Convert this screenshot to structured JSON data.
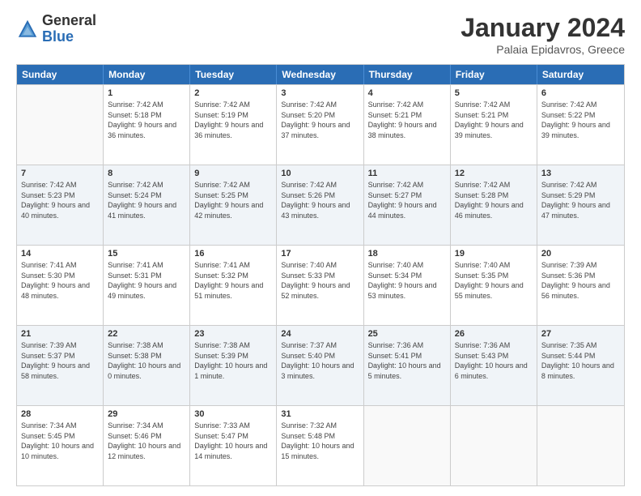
{
  "logo": {
    "general": "General",
    "blue": "Blue"
  },
  "title": {
    "month": "January 2024",
    "location": "Palaia Epidavros, Greece"
  },
  "calendar": {
    "days": [
      "Sunday",
      "Monday",
      "Tuesday",
      "Wednesday",
      "Thursday",
      "Friday",
      "Saturday"
    ],
    "rows": [
      [
        {
          "day": "",
          "sunrise": "",
          "sunset": "",
          "daylight": "",
          "empty": true
        },
        {
          "day": "1",
          "sunrise": "Sunrise: 7:42 AM",
          "sunset": "Sunset: 5:18 PM",
          "daylight": "Daylight: 9 hours and 36 minutes."
        },
        {
          "day": "2",
          "sunrise": "Sunrise: 7:42 AM",
          "sunset": "Sunset: 5:19 PM",
          "daylight": "Daylight: 9 hours and 36 minutes."
        },
        {
          "day": "3",
          "sunrise": "Sunrise: 7:42 AM",
          "sunset": "Sunset: 5:20 PM",
          "daylight": "Daylight: 9 hours and 37 minutes."
        },
        {
          "day": "4",
          "sunrise": "Sunrise: 7:42 AM",
          "sunset": "Sunset: 5:21 PM",
          "daylight": "Daylight: 9 hours and 38 minutes."
        },
        {
          "day": "5",
          "sunrise": "Sunrise: 7:42 AM",
          "sunset": "Sunset: 5:21 PM",
          "daylight": "Daylight: 9 hours and 39 minutes."
        },
        {
          "day": "6",
          "sunrise": "Sunrise: 7:42 AM",
          "sunset": "Sunset: 5:22 PM",
          "daylight": "Daylight: 9 hours and 39 minutes."
        }
      ],
      [
        {
          "day": "7",
          "sunrise": "Sunrise: 7:42 AM",
          "sunset": "Sunset: 5:23 PM",
          "daylight": "Daylight: 9 hours and 40 minutes."
        },
        {
          "day": "8",
          "sunrise": "Sunrise: 7:42 AM",
          "sunset": "Sunset: 5:24 PM",
          "daylight": "Daylight: 9 hours and 41 minutes."
        },
        {
          "day": "9",
          "sunrise": "Sunrise: 7:42 AM",
          "sunset": "Sunset: 5:25 PM",
          "daylight": "Daylight: 9 hours and 42 minutes."
        },
        {
          "day": "10",
          "sunrise": "Sunrise: 7:42 AM",
          "sunset": "Sunset: 5:26 PM",
          "daylight": "Daylight: 9 hours and 43 minutes."
        },
        {
          "day": "11",
          "sunrise": "Sunrise: 7:42 AM",
          "sunset": "Sunset: 5:27 PM",
          "daylight": "Daylight: 9 hours and 44 minutes."
        },
        {
          "day": "12",
          "sunrise": "Sunrise: 7:42 AM",
          "sunset": "Sunset: 5:28 PM",
          "daylight": "Daylight: 9 hours and 46 minutes."
        },
        {
          "day": "13",
          "sunrise": "Sunrise: 7:42 AM",
          "sunset": "Sunset: 5:29 PM",
          "daylight": "Daylight: 9 hours and 47 minutes."
        }
      ],
      [
        {
          "day": "14",
          "sunrise": "Sunrise: 7:41 AM",
          "sunset": "Sunset: 5:30 PM",
          "daylight": "Daylight: 9 hours and 48 minutes."
        },
        {
          "day": "15",
          "sunrise": "Sunrise: 7:41 AM",
          "sunset": "Sunset: 5:31 PM",
          "daylight": "Daylight: 9 hours and 49 minutes."
        },
        {
          "day": "16",
          "sunrise": "Sunrise: 7:41 AM",
          "sunset": "Sunset: 5:32 PM",
          "daylight": "Daylight: 9 hours and 51 minutes."
        },
        {
          "day": "17",
          "sunrise": "Sunrise: 7:40 AM",
          "sunset": "Sunset: 5:33 PM",
          "daylight": "Daylight: 9 hours and 52 minutes."
        },
        {
          "day": "18",
          "sunrise": "Sunrise: 7:40 AM",
          "sunset": "Sunset: 5:34 PM",
          "daylight": "Daylight: 9 hours and 53 minutes."
        },
        {
          "day": "19",
          "sunrise": "Sunrise: 7:40 AM",
          "sunset": "Sunset: 5:35 PM",
          "daylight": "Daylight: 9 hours and 55 minutes."
        },
        {
          "day": "20",
          "sunrise": "Sunrise: 7:39 AM",
          "sunset": "Sunset: 5:36 PM",
          "daylight": "Daylight: 9 hours and 56 minutes."
        }
      ],
      [
        {
          "day": "21",
          "sunrise": "Sunrise: 7:39 AM",
          "sunset": "Sunset: 5:37 PM",
          "daylight": "Daylight: 9 hours and 58 minutes."
        },
        {
          "day": "22",
          "sunrise": "Sunrise: 7:38 AM",
          "sunset": "Sunset: 5:38 PM",
          "daylight": "Daylight: 10 hours and 0 minutes."
        },
        {
          "day": "23",
          "sunrise": "Sunrise: 7:38 AM",
          "sunset": "Sunset: 5:39 PM",
          "daylight": "Daylight: 10 hours and 1 minute."
        },
        {
          "day": "24",
          "sunrise": "Sunrise: 7:37 AM",
          "sunset": "Sunset: 5:40 PM",
          "daylight": "Daylight: 10 hours and 3 minutes."
        },
        {
          "day": "25",
          "sunrise": "Sunrise: 7:36 AM",
          "sunset": "Sunset: 5:41 PM",
          "daylight": "Daylight: 10 hours and 5 minutes."
        },
        {
          "day": "26",
          "sunrise": "Sunrise: 7:36 AM",
          "sunset": "Sunset: 5:43 PM",
          "daylight": "Daylight: 10 hours and 6 minutes."
        },
        {
          "day": "27",
          "sunrise": "Sunrise: 7:35 AM",
          "sunset": "Sunset: 5:44 PM",
          "daylight": "Daylight: 10 hours and 8 minutes."
        }
      ],
      [
        {
          "day": "28",
          "sunrise": "Sunrise: 7:34 AM",
          "sunset": "Sunset: 5:45 PM",
          "daylight": "Daylight: 10 hours and 10 minutes."
        },
        {
          "day": "29",
          "sunrise": "Sunrise: 7:34 AM",
          "sunset": "Sunset: 5:46 PM",
          "daylight": "Daylight: 10 hours and 12 minutes."
        },
        {
          "day": "30",
          "sunrise": "Sunrise: 7:33 AM",
          "sunset": "Sunset: 5:47 PM",
          "daylight": "Daylight: 10 hours and 14 minutes."
        },
        {
          "day": "31",
          "sunrise": "Sunrise: 7:32 AM",
          "sunset": "Sunset: 5:48 PM",
          "daylight": "Daylight: 10 hours and 15 minutes."
        },
        {
          "day": "",
          "sunrise": "",
          "sunset": "",
          "daylight": "",
          "empty": true
        },
        {
          "day": "",
          "sunrise": "",
          "sunset": "",
          "daylight": "",
          "empty": true
        },
        {
          "day": "",
          "sunrise": "",
          "sunset": "",
          "daylight": "",
          "empty": true
        }
      ]
    ]
  }
}
